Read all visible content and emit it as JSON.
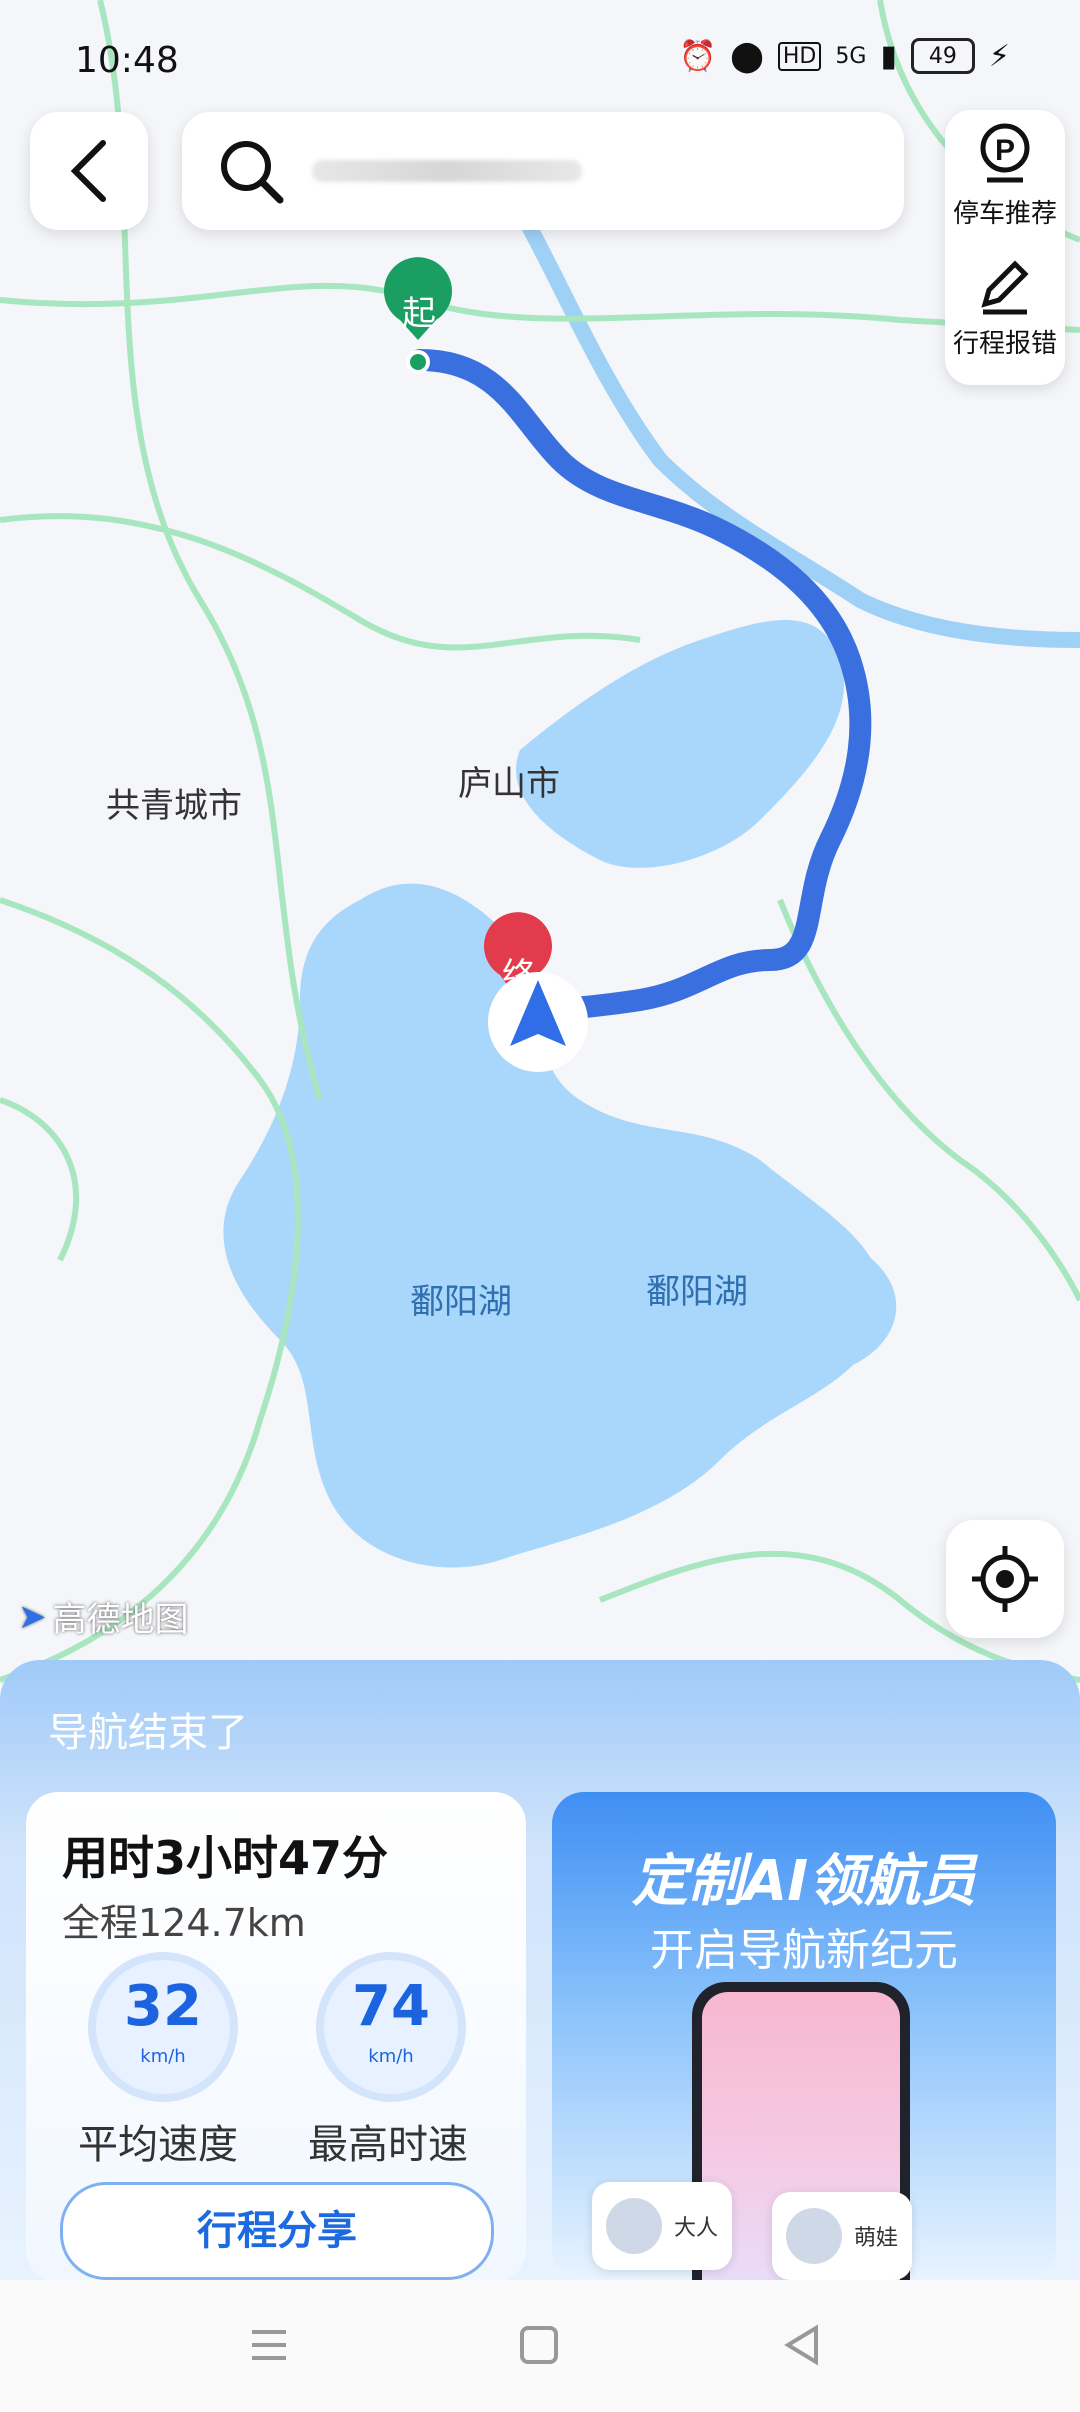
{
  "status_bar": {
    "time": "10:48",
    "signal": "5G",
    "hd": "HD",
    "battery": "49"
  },
  "search": {
    "placeholder": ""
  },
  "side_tools": {
    "parking_label": "停车推荐",
    "report_label": "行程报错"
  },
  "map": {
    "start_marker": "起",
    "end_marker": "终",
    "labels": {
      "gongqing": "共青城市",
      "lushan": "庐山市",
      "lake1": "鄱阳湖",
      "lake2": "鄱阳湖"
    },
    "logo": "高德地图"
  },
  "summary": {
    "title": "导航结束了",
    "duration": "用时3小时47分",
    "distance": "全程124.7km",
    "avg_speed": "32",
    "avg_unit": "km/h",
    "avg_label": "平均速度",
    "max_speed": "74",
    "max_unit": "km/h",
    "max_label": "最高时速",
    "share_button": "行程分享"
  },
  "promo": {
    "headline": "定制AI领航员",
    "subline": "开启导航新纪元",
    "chip1": "大人",
    "chip2": "萌娃"
  }
}
